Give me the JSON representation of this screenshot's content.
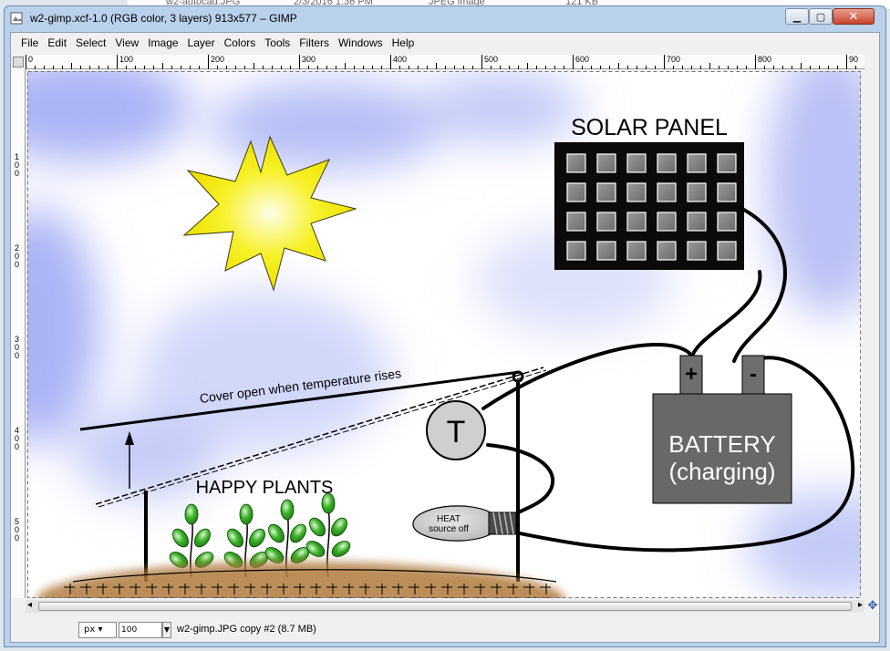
{
  "background_window": {
    "file_name": "w2-autocad.JPG",
    "date": "2/3/2016 1:36 PM",
    "type": "JPEG image",
    "size": "121 KB"
  },
  "window": {
    "title": "w2-gimp.xcf-1.0 (RGB color, 3 layers) 913x577 – GIMP",
    "minimize_icon": "minimize-icon",
    "maximize_icon": "maximize-icon",
    "close_icon": "close-icon"
  },
  "menu": [
    {
      "label": "File"
    },
    {
      "label": "Edit"
    },
    {
      "label": "Select"
    },
    {
      "label": "View"
    },
    {
      "label": "Image"
    },
    {
      "label": "Layer"
    },
    {
      "label": "Colors"
    },
    {
      "label": "Tools"
    },
    {
      "label": "Filters"
    },
    {
      "label": "Windows"
    },
    {
      "label": "Help"
    }
  ],
  "rulers": {
    "horizontal_labels": [
      "0",
      "100",
      "200",
      "300",
      "400",
      "500",
      "600",
      "700",
      "800",
      "90"
    ],
    "vertical_labels": [
      "100",
      "200",
      "300",
      "400",
      "500"
    ]
  },
  "drawing": {
    "solar_panel_label": "SOLAR PANEL",
    "cover_label": "Cover open when temperature rises",
    "plants_label": "HAPPY PLANTS",
    "thermostat_label": "T",
    "heat_label_line1": "HEAT",
    "heat_label_line2": "source off",
    "battery_label_line1": "BATTERY",
    "battery_label_line2": "(charging)",
    "battery_plus": "+",
    "battery_minus": "-",
    "colors": {
      "sky_blue": "#aab4f5",
      "sun_yellow": "#f4ee1a",
      "panel_black": "#0a0a0a",
      "battery_gray": "#686868",
      "plant_green": "#2fa020",
      "soil_brown": "#b07a3c"
    }
  },
  "status": {
    "unit": "px",
    "zoom": "100",
    "file_info": "w2-gimp.JPG copy #2 (8.7 MB)"
  }
}
